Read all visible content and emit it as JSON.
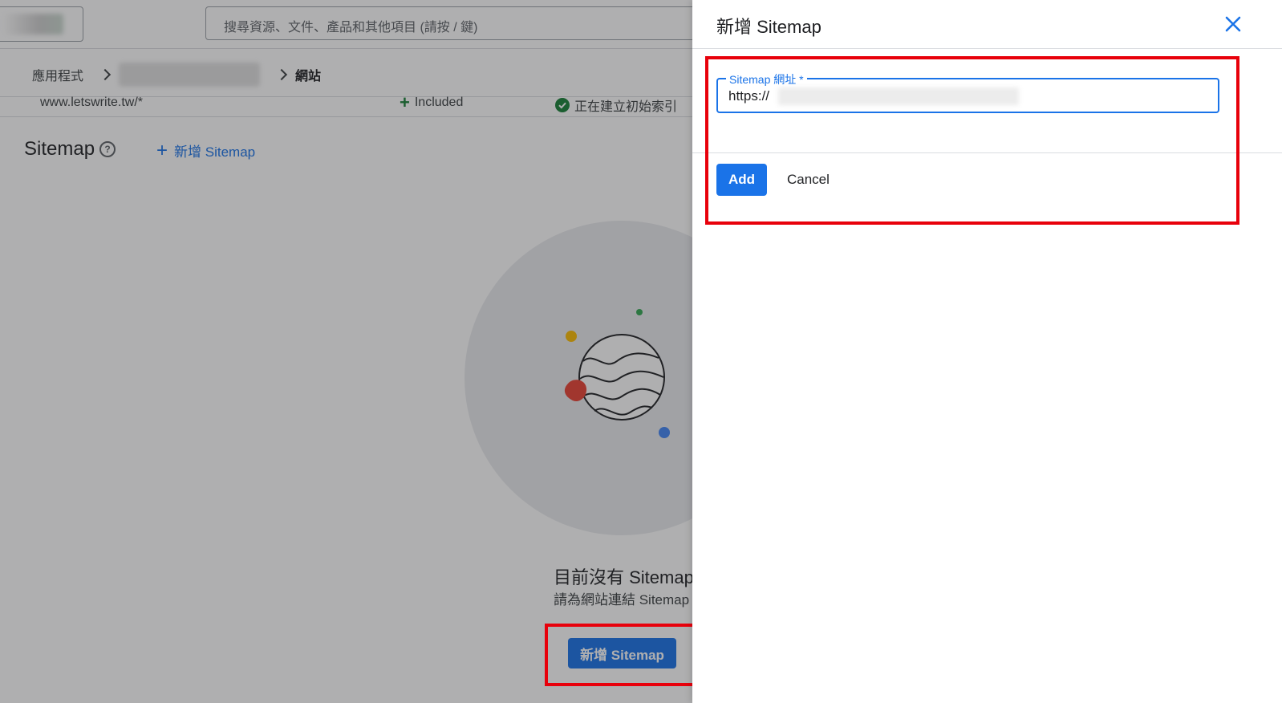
{
  "header": {
    "search_placeholder": "搜尋資源、文件、產品和其他項目 (請按 / 鍵)"
  },
  "breadcrumb": {
    "first": "應用程式",
    "last": "網站"
  },
  "site_row": {
    "url": "www.letswrite.tw/*",
    "inclusion": "Included",
    "status": "正在建立初始索引"
  },
  "sitemap_section": {
    "title": "Sitemap",
    "add_link_label": "新增 Sitemap",
    "empty_title": "目前沒有 Sitemap",
    "empty_subtitle": "請為網站連結 Sitemap",
    "add_button_label": "新增 Sitemap"
  },
  "dialog": {
    "title": "新增 Sitemap",
    "field_label": "Sitemap 網址 *",
    "field_value": "https://",
    "add_label": "Add",
    "cancel_label": "Cancel"
  },
  "colors": {
    "primary": "#1a73e8",
    "success": "#188038",
    "highlight": "#e8000b"
  },
  "icons": [
    "chevron-right-icon",
    "plus-icon",
    "check-circle-icon",
    "help-icon",
    "close-icon",
    "globe-illustration"
  ]
}
